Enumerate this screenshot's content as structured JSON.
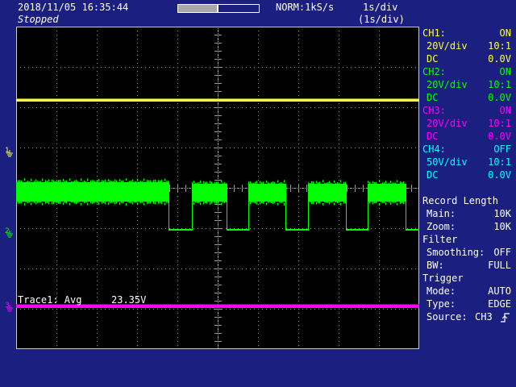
{
  "header": {
    "datetime": "2018/11/05  16:35:44",
    "status": "Stopped",
    "acq_mode": "NORM:1kS/s",
    "timebase": "1s/div",
    "timebase_zoom": "(1s/div)",
    "record_progress": 0.5
  },
  "colors": {
    "background": "#1a1f80",
    "ch1": "#ffff40",
    "ch2": "#00ff00",
    "ch3": "#ff00ff",
    "ch4": "#00ffff",
    "grid": "#9a9a9a"
  },
  "channels": [
    {
      "name": "CH1:",
      "state": "ON",
      "vdiv": "20V/div",
      "probe": "10:1",
      "coupling": "DC",
      "offset": "0.0V"
    },
    {
      "name": "CH2:",
      "state": "ON",
      "vdiv": "20V/div",
      "probe": "10:1",
      "coupling": "DC",
      "offset": "0.0V"
    },
    {
      "name": "CH3:",
      "state": "ON",
      "vdiv": "20V/div",
      "probe": "10:1",
      "coupling": "DC",
      "offset": "0.0V"
    },
    {
      "name": "CH4:",
      "state": "OFF",
      "vdiv": "50V/div",
      "probe": "10:1",
      "coupling": "DC",
      "offset": "0.0V"
    }
  ],
  "record_length": {
    "title": "Record Length",
    "main_label": "Main:",
    "main_value": "10K",
    "zoom_label": "Zoom:",
    "zoom_value": "10K"
  },
  "filter": {
    "title": "Filter",
    "smoothing_label": "Smoothing:",
    "smoothing_value": "OFF",
    "bw_label": "BW:",
    "bw_value": "FULL"
  },
  "trigger": {
    "title": "Trigger",
    "mode_label": "Mode:",
    "mode_value": "AUTO",
    "type_label": "Type:",
    "type_value": "EDGE",
    "source_label": "Source:",
    "source_value": "CH3"
  },
  "measurement": {
    "label": "Trace1: Avg",
    "value": "23.35V"
  },
  "markers": {
    "ch1": "1",
    "ch2": "2",
    "ch3": "3"
  }
}
